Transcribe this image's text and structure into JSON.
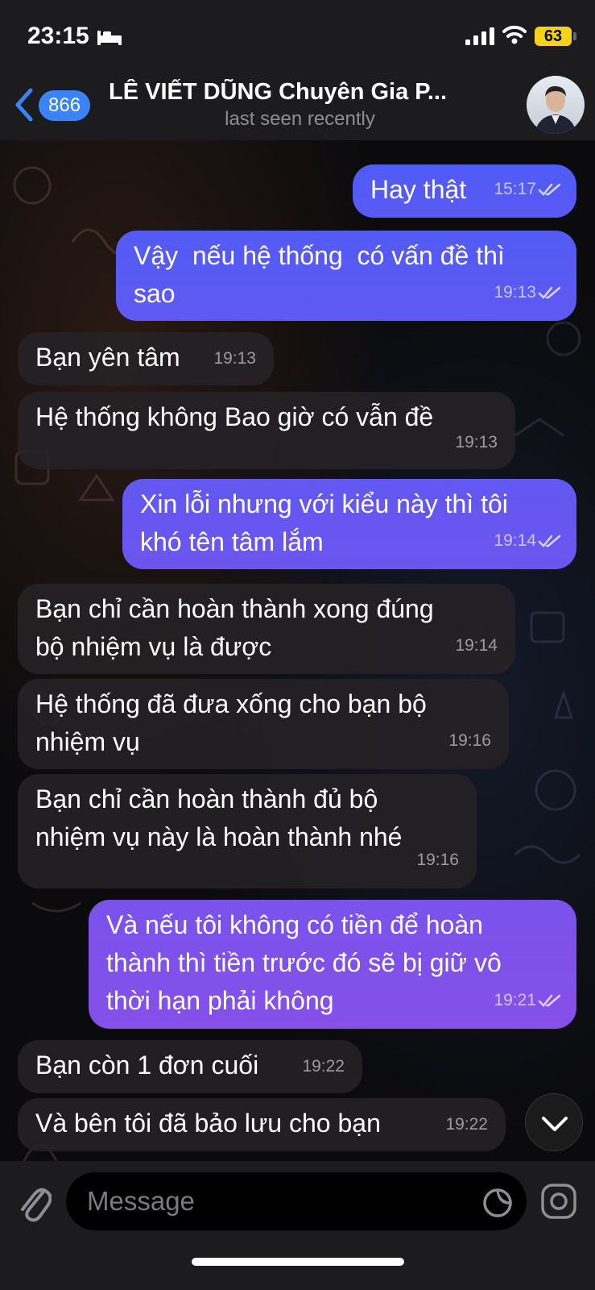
{
  "status": {
    "time": "23:15",
    "battery": "63"
  },
  "header": {
    "back_count": "866",
    "title": "LÊ VIẾT DŨNG Chuyên Gia P...",
    "subtitle": "last seen recently"
  },
  "messages": [
    {
      "dir": "out",
      "text": "Hay thật",
      "time": "15:17"
    },
    {
      "dir": "out",
      "text": "Vậy  nếu hệ thống  có vấn đề thì\nsao",
      "time": "19:13"
    },
    {
      "dir": "in",
      "text": "Bạn yên tâm",
      "time": "19:13"
    },
    {
      "dir": "in",
      "text": "Hệ thống không Bao giờ có vẫn đề",
      "time": "19:13"
    },
    {
      "dir": "out",
      "text": "Xin lỗi nhưng với kiểu này thì tôi\nkhó tên tâm lắm",
      "time": "19:14"
    },
    {
      "dir": "in",
      "text": "Bạn chỉ cần hoàn thành xong đúng\nbộ nhiệm vụ là được",
      "time": "19:14"
    },
    {
      "dir": "in",
      "text": "Hệ thống đã đưa xống cho bạn bộ\nnhiệm vụ",
      "time": "19:16"
    },
    {
      "dir": "in",
      "text": "Bạn chỉ cần hoàn thành đủ bộ\nnhiệm vụ này là hoàn thành nhé",
      "time": "19:16"
    },
    {
      "dir": "out",
      "text": "Và nếu tôi không có tiền để hoàn\nthành thì tiền trước đó sẽ bị giữ vô\nthời hạn phải không",
      "time": "19:21"
    },
    {
      "dir": "in",
      "text": "Bạn còn 1 đơn cuối",
      "time": "19:22"
    },
    {
      "dir": "in",
      "text": "Và bên tôi đã bảo lưu cho bạn",
      "time": "19:22"
    }
  ],
  "composer": {
    "placeholder": "Message"
  },
  "colors": {
    "outgoing_blue": "#4f5cf6",
    "outgoing_purple": "#8a4fe8",
    "incoming": "#262226",
    "accent": "#3a84f7"
  }
}
